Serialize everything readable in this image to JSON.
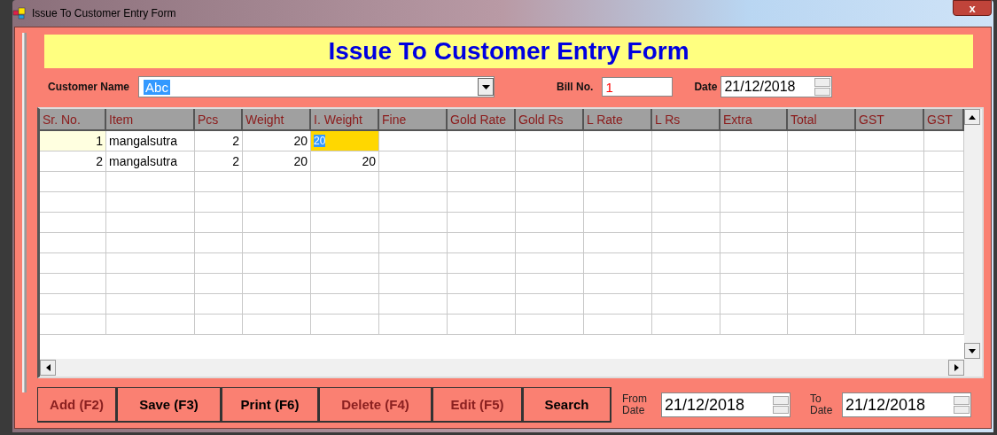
{
  "window": {
    "title": "Issue To Customer Entry Form",
    "close": "x"
  },
  "heading": "Issue To Customer Entry Form",
  "customer": {
    "label": "Customer Name",
    "value": "Abc"
  },
  "bill": {
    "label": "Bill No.",
    "value": "1"
  },
  "date": {
    "label": "Date",
    "value": "21/12/2018"
  },
  "table": {
    "columns": [
      "Sr. No.",
      "Item",
      "Pcs",
      "Weight",
      "I. Weight",
      "Fine",
      "Gold Rate",
      "Gold Rs",
      "L Rate",
      "L Rs",
      "Extra",
      "Total",
      "GST",
      "GST"
    ],
    "rows": [
      {
        "selected": true,
        "cells": [
          {
            "text": "1",
            "editing": false
          },
          {
            "text": "mangalsutra",
            "editing": false
          },
          {
            "text": "2",
            "editing": false
          },
          {
            "text": "20",
            "editing": false
          },
          {
            "text": "20",
            "editing": true
          }
        ]
      },
      {
        "selected": false,
        "cells": [
          {
            "text": "2",
            "editing": false
          },
          {
            "text": "mangalsutra",
            "editing": false
          },
          {
            "text": "2",
            "editing": false
          },
          {
            "text": "20",
            "editing": false
          },
          {
            "text": "20",
            "editing": false
          }
        ]
      }
    ]
  },
  "buttons": [
    {
      "label": "Add (F2)",
      "disabled": true
    },
    {
      "label": "Save (F3)",
      "disabled": false
    },
    {
      "label": "Print (F6)",
      "disabled": false
    },
    {
      "label": "Delete (F4)",
      "disabled": true
    },
    {
      "label": "Edit (F5)",
      "disabled": true
    },
    {
      "label": "Search",
      "disabled": false
    }
  ],
  "from_date": {
    "label": "From Date",
    "value": "21/12/2018"
  },
  "to_date": {
    "label": "To Date",
    "value": "21/12/2018"
  }
}
